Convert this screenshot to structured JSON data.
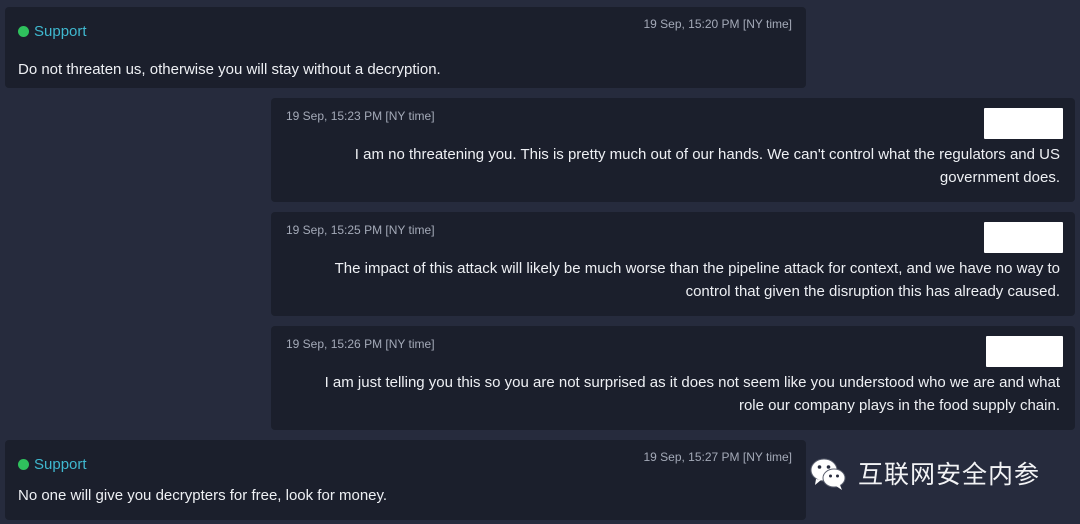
{
  "messages": [
    {
      "sender": "Support",
      "time": "19 Sep, 15:20 PM [NY time]",
      "lines": [
        "Do not threaten us, otherwise you will stay without a decryption."
      ]
    },
    {
      "time": "19 Sep, 15:23 PM [NY time]",
      "lines": [
        "I am no threatening you. This is pretty much out of our hands. We can't control what the regulators and US",
        "government does."
      ]
    },
    {
      "time": "19 Sep, 15:25 PM [NY time]",
      "lines": [
        "The impact of this attack will likely be much worse than the pipeline attack for context, and we have no way to",
        "control that given the disruption this has already caused."
      ]
    },
    {
      "time": "19 Sep, 15:26 PM [NY time]",
      "lines": [
        "I am just telling you this so you are not surprised as it does not seem like you understood who we are and what",
        "role our company plays in the food supply chain."
      ]
    },
    {
      "sender": "Support",
      "time": "19 Sep, 15:27 PM [NY time]",
      "lines": [
        "No one will give you decrypters for free, look for money."
      ]
    }
  ],
  "watermark": {
    "text": "互联网安全内参",
    "icon": "wechat-icon"
  },
  "colors": {
    "background": "#262b3d",
    "bubble": "#1b1f2c",
    "sender": "#3fb8cf",
    "online_dot": "#2fc15d",
    "timestamp": "#a4aab8",
    "text": "#eef0f4"
  }
}
